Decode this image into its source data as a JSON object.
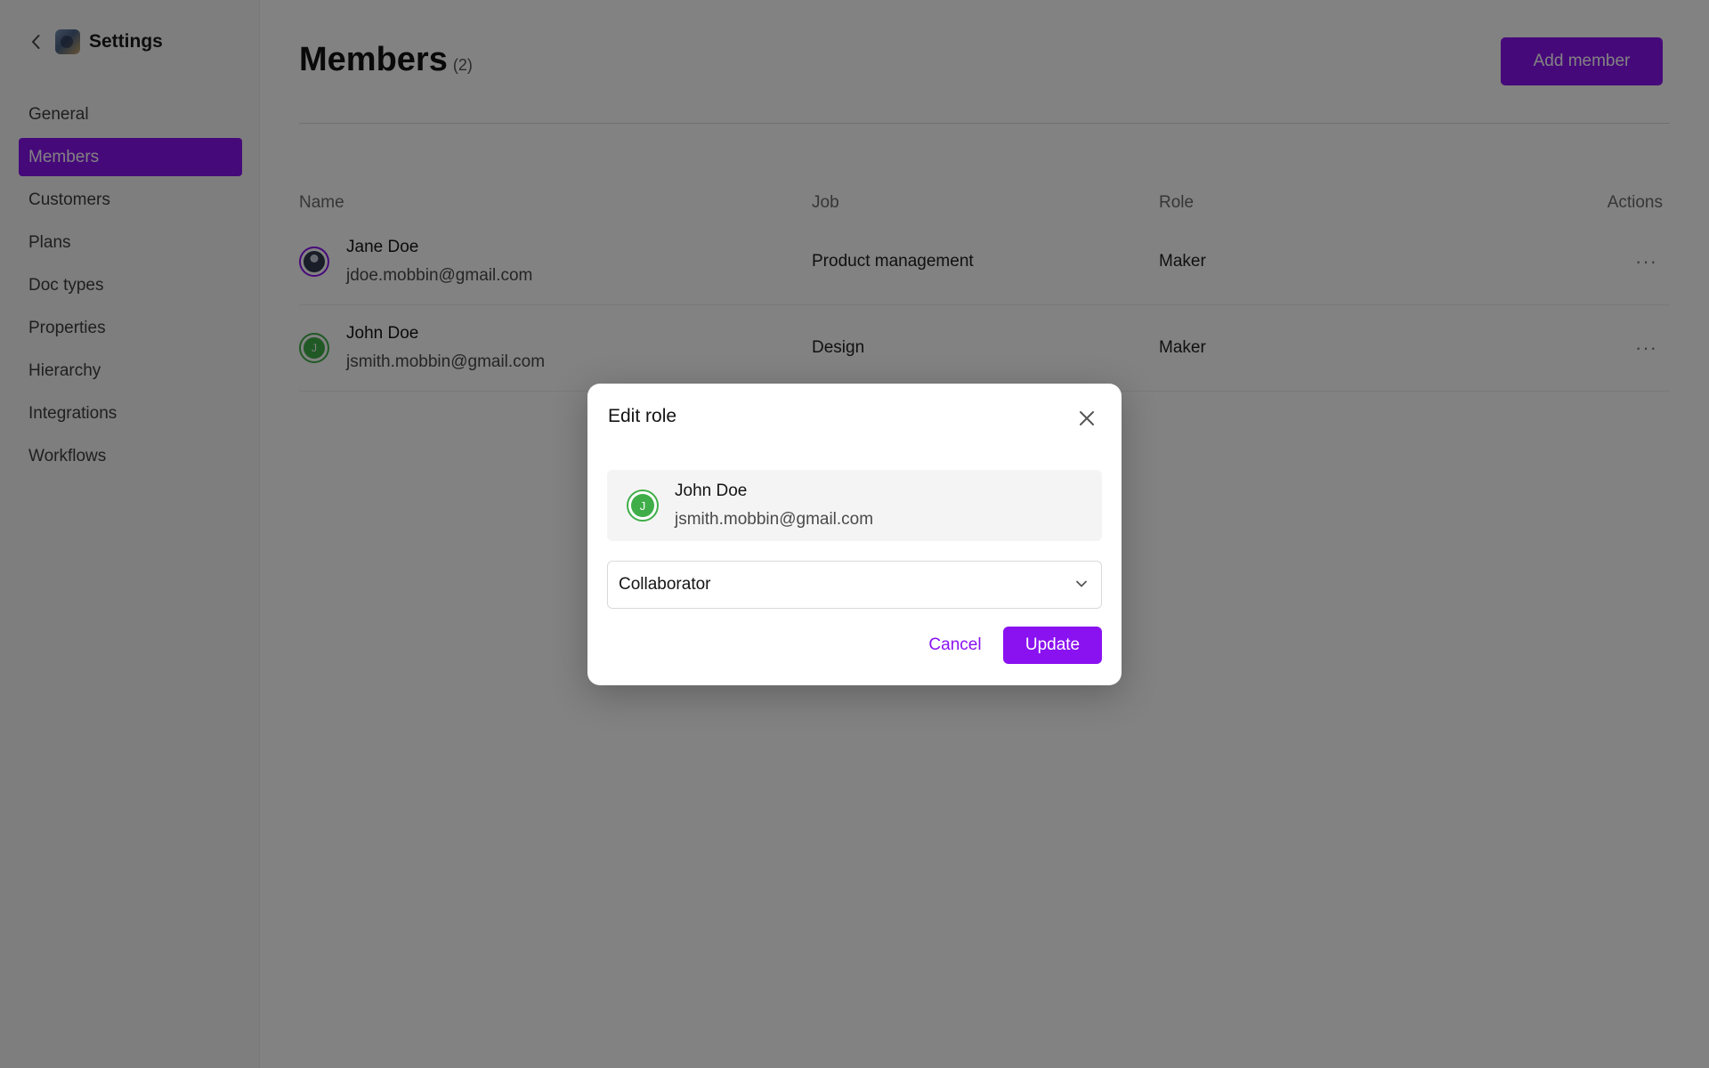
{
  "sidebar": {
    "title": "Settings",
    "back_icon": "chevron-left-icon",
    "items": [
      {
        "label": "General",
        "active": false
      },
      {
        "label": "Members",
        "active": true
      },
      {
        "label": "Customers",
        "active": false
      },
      {
        "label": "Plans",
        "active": false
      },
      {
        "label": "Doc types",
        "active": false
      },
      {
        "label": "Properties",
        "active": false
      },
      {
        "label": "Hierarchy",
        "active": false
      },
      {
        "label": "Integrations",
        "active": false
      },
      {
        "label": "Workflows",
        "active": false
      }
    ]
  },
  "header": {
    "title": "Members",
    "count": "(2)",
    "add_button_label": "Add member"
  },
  "table": {
    "columns": {
      "name": "Name",
      "job": "Job",
      "role": "Role",
      "actions": "Actions"
    },
    "rows": [
      {
        "name": "Jane Doe",
        "email": "jdoe.mobbin@gmail.com",
        "job": "Product management",
        "role": "Maker",
        "avatar": "photo",
        "actions_label": "···"
      },
      {
        "name": "John Doe",
        "email": "jsmith.mobbin@gmail.com",
        "job": "Design",
        "role": "Maker",
        "avatar": "J",
        "actions_label": "···"
      }
    ]
  },
  "modal": {
    "title": "Edit role",
    "member": {
      "name": "John Doe",
      "email": "jsmith.mobbin@gmail.com",
      "avatar_letter": "J"
    },
    "role_select": {
      "value": "Collaborator"
    },
    "cancel_label": "Cancel",
    "update_label": "Update"
  },
  "colors": {
    "accent": "#8a12f0",
    "avatar_green": "#3fae49",
    "overlay": "rgba(0,0,0,0.49)"
  }
}
